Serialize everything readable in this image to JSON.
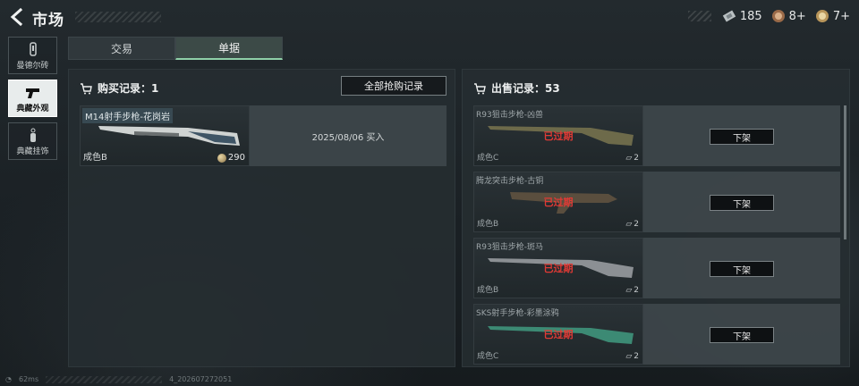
{
  "header": {
    "title": "市场",
    "currencies": [
      {
        "icon": "ticket-icon",
        "value": "185"
      },
      {
        "icon": "bronze-coin-icon",
        "value": "8+"
      },
      {
        "icon": "gold-coin-icon",
        "value": "7+"
      }
    ]
  },
  "sidenav": {
    "items": [
      {
        "label": "曼德尔砖",
        "icon": "brick-icon",
        "active": false
      },
      {
        "label": "典藏外观",
        "icon": "pistol-icon",
        "active": true
      },
      {
        "label": "典藏挂饰",
        "icon": "charm-icon",
        "active": false
      }
    ]
  },
  "tabs": [
    {
      "label": "交易",
      "active": false
    },
    {
      "label": "单据",
      "active": true
    }
  ],
  "buy_panel": {
    "title": "购买记录：1",
    "all_button": "全部抢购记录",
    "items": [
      {
        "name": "M14射手步枪-花岗岩",
        "grade": "成色B",
        "price": "290",
        "info": "2025/08/06 买入"
      }
    ]
  },
  "sell_panel": {
    "title": "出售记录：53",
    "items": [
      {
        "name": "R93狙击步枪-凶兽",
        "grade": "成色C",
        "status": "已过期",
        "count": "2",
        "button": "下架",
        "color": "#6d6a4a"
      },
      {
        "name": "腾龙突击步枪-古铜",
        "grade": "成色B",
        "status": "已过期",
        "count": "2",
        "button": "下架",
        "color": "#5a4e3e"
      },
      {
        "name": "R93狙击步枪-斑马",
        "grade": "成色B",
        "status": "已过期",
        "count": "2",
        "button": "下架",
        "color": "#8c9094"
      },
      {
        "name": "SKS射手步枪-彩墨涂鸦",
        "grade": "成色C",
        "status": "已过期",
        "count": "2",
        "button": "下架",
        "color": "#3c8a74"
      }
    ]
  },
  "footer": {
    "ping": "62ms",
    "build": "4_202607272051"
  }
}
